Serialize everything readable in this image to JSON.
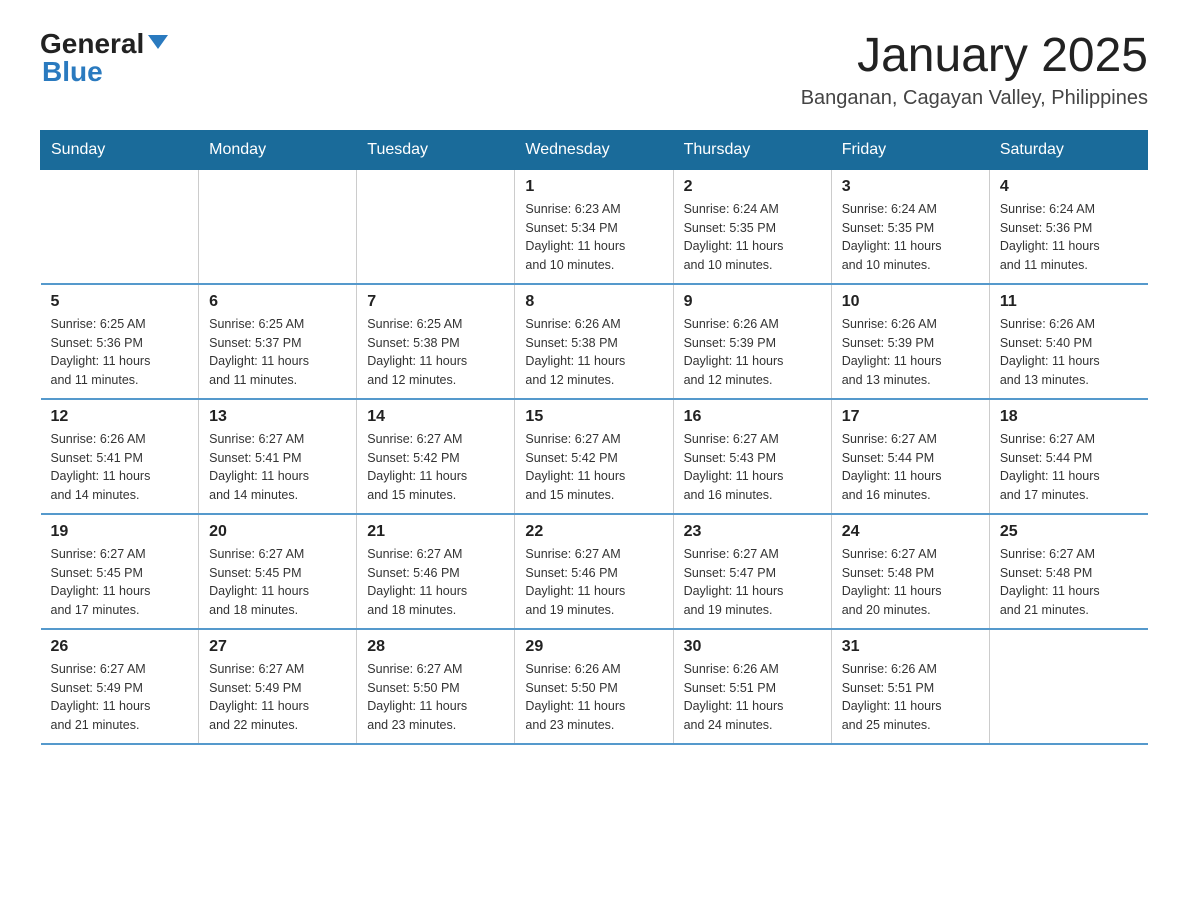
{
  "logo": {
    "general": "General",
    "blue": "Blue"
  },
  "title": "January 2025",
  "location": "Banganan, Cagayan Valley, Philippines",
  "days_header": [
    "Sunday",
    "Monday",
    "Tuesday",
    "Wednesday",
    "Thursday",
    "Friday",
    "Saturday"
  ],
  "weeks": [
    [
      {
        "day": "",
        "info": ""
      },
      {
        "day": "",
        "info": ""
      },
      {
        "day": "",
        "info": ""
      },
      {
        "day": "1",
        "info": "Sunrise: 6:23 AM\nSunset: 5:34 PM\nDaylight: 11 hours\nand 10 minutes."
      },
      {
        "day": "2",
        "info": "Sunrise: 6:24 AM\nSunset: 5:35 PM\nDaylight: 11 hours\nand 10 minutes."
      },
      {
        "day": "3",
        "info": "Sunrise: 6:24 AM\nSunset: 5:35 PM\nDaylight: 11 hours\nand 10 minutes."
      },
      {
        "day": "4",
        "info": "Sunrise: 6:24 AM\nSunset: 5:36 PM\nDaylight: 11 hours\nand 11 minutes."
      }
    ],
    [
      {
        "day": "5",
        "info": "Sunrise: 6:25 AM\nSunset: 5:36 PM\nDaylight: 11 hours\nand 11 minutes."
      },
      {
        "day": "6",
        "info": "Sunrise: 6:25 AM\nSunset: 5:37 PM\nDaylight: 11 hours\nand 11 minutes."
      },
      {
        "day": "7",
        "info": "Sunrise: 6:25 AM\nSunset: 5:38 PM\nDaylight: 11 hours\nand 12 minutes."
      },
      {
        "day": "8",
        "info": "Sunrise: 6:26 AM\nSunset: 5:38 PM\nDaylight: 11 hours\nand 12 minutes."
      },
      {
        "day": "9",
        "info": "Sunrise: 6:26 AM\nSunset: 5:39 PM\nDaylight: 11 hours\nand 12 minutes."
      },
      {
        "day": "10",
        "info": "Sunrise: 6:26 AM\nSunset: 5:39 PM\nDaylight: 11 hours\nand 13 minutes."
      },
      {
        "day": "11",
        "info": "Sunrise: 6:26 AM\nSunset: 5:40 PM\nDaylight: 11 hours\nand 13 minutes."
      }
    ],
    [
      {
        "day": "12",
        "info": "Sunrise: 6:26 AM\nSunset: 5:41 PM\nDaylight: 11 hours\nand 14 minutes."
      },
      {
        "day": "13",
        "info": "Sunrise: 6:27 AM\nSunset: 5:41 PM\nDaylight: 11 hours\nand 14 minutes."
      },
      {
        "day": "14",
        "info": "Sunrise: 6:27 AM\nSunset: 5:42 PM\nDaylight: 11 hours\nand 15 minutes."
      },
      {
        "day": "15",
        "info": "Sunrise: 6:27 AM\nSunset: 5:42 PM\nDaylight: 11 hours\nand 15 minutes."
      },
      {
        "day": "16",
        "info": "Sunrise: 6:27 AM\nSunset: 5:43 PM\nDaylight: 11 hours\nand 16 minutes."
      },
      {
        "day": "17",
        "info": "Sunrise: 6:27 AM\nSunset: 5:44 PM\nDaylight: 11 hours\nand 16 minutes."
      },
      {
        "day": "18",
        "info": "Sunrise: 6:27 AM\nSunset: 5:44 PM\nDaylight: 11 hours\nand 17 minutes."
      }
    ],
    [
      {
        "day": "19",
        "info": "Sunrise: 6:27 AM\nSunset: 5:45 PM\nDaylight: 11 hours\nand 17 minutes."
      },
      {
        "day": "20",
        "info": "Sunrise: 6:27 AM\nSunset: 5:45 PM\nDaylight: 11 hours\nand 18 minutes."
      },
      {
        "day": "21",
        "info": "Sunrise: 6:27 AM\nSunset: 5:46 PM\nDaylight: 11 hours\nand 18 minutes."
      },
      {
        "day": "22",
        "info": "Sunrise: 6:27 AM\nSunset: 5:46 PM\nDaylight: 11 hours\nand 19 minutes."
      },
      {
        "day": "23",
        "info": "Sunrise: 6:27 AM\nSunset: 5:47 PM\nDaylight: 11 hours\nand 19 minutes."
      },
      {
        "day": "24",
        "info": "Sunrise: 6:27 AM\nSunset: 5:48 PM\nDaylight: 11 hours\nand 20 minutes."
      },
      {
        "day": "25",
        "info": "Sunrise: 6:27 AM\nSunset: 5:48 PM\nDaylight: 11 hours\nand 21 minutes."
      }
    ],
    [
      {
        "day": "26",
        "info": "Sunrise: 6:27 AM\nSunset: 5:49 PM\nDaylight: 11 hours\nand 21 minutes."
      },
      {
        "day": "27",
        "info": "Sunrise: 6:27 AM\nSunset: 5:49 PM\nDaylight: 11 hours\nand 22 minutes."
      },
      {
        "day": "28",
        "info": "Sunrise: 6:27 AM\nSunset: 5:50 PM\nDaylight: 11 hours\nand 23 minutes."
      },
      {
        "day": "29",
        "info": "Sunrise: 6:26 AM\nSunset: 5:50 PM\nDaylight: 11 hours\nand 23 minutes."
      },
      {
        "day": "30",
        "info": "Sunrise: 6:26 AM\nSunset: 5:51 PM\nDaylight: 11 hours\nand 24 minutes."
      },
      {
        "day": "31",
        "info": "Sunrise: 6:26 AM\nSunset: 5:51 PM\nDaylight: 11 hours\nand 25 minutes."
      },
      {
        "day": "",
        "info": ""
      }
    ]
  ]
}
